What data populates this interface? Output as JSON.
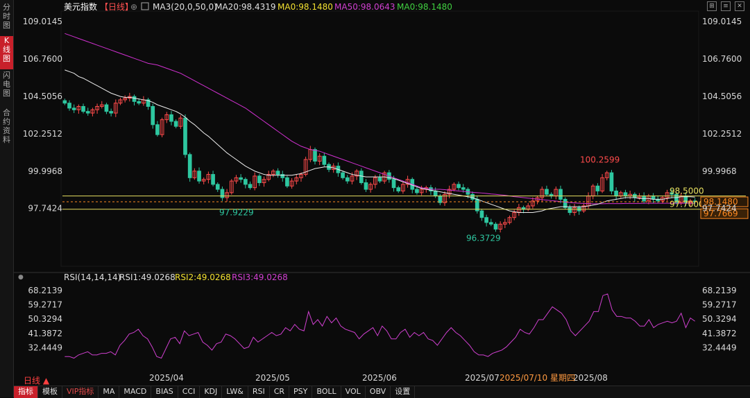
{
  "sidebar": {
    "tabs": [
      {
        "label": "分时图",
        "active": false
      },
      {
        "label": "K线图",
        "active": true
      },
      {
        "label": "闪电图",
        "active": false
      },
      {
        "label": "合约资料",
        "active": false
      }
    ]
  },
  "header": {
    "title": "美元指数",
    "period": "【日线】",
    "ma_legend": "MA3(20,0,50,0)",
    "ma20": "MA20:98.4319",
    "ma0a": "MA0:98.1480",
    "ma50": "MA50:98.0643",
    "ma0b": "MA0:98.1480"
  },
  "rsi_header": {
    "name": "RSI(14,14,14)",
    "rsi1": "RSI1:49.0268",
    "rsi2": "RSI2:49.0268",
    "rsi3": "RSI3:49.0268"
  },
  "period_label": "日线 ▲",
  "bottombar": {
    "items": [
      "指标",
      "模板",
      "VIP指标",
      "MA",
      "MACD",
      "BIAS",
      "CCI",
      "KDJ",
      "LW&",
      "RSI",
      "CR",
      "PSY",
      "BOLL",
      "VOL",
      "OBV",
      "设置"
    ]
  },
  "colors": {
    "up": "#ff4b4b",
    "down": "#2ec7a0",
    "ma20": "#ffffff",
    "ma50": "#d030d0",
    "rsi": "#d040d0",
    "hline": "#e8e060",
    "last_price_tag": "#ff8a20"
  },
  "chart_data": [
    {
      "type": "candlestick",
      "title": "美元指数",
      "y_ticks": [
        "109.0145",
        "106.7600",
        "104.5056",
        "102.2512",
        "99.9968",
        "97.7424"
      ],
      "ylim": [
        96.1,
        109.4
      ],
      "x_tick_labels": [
        "2025/04",
        "2025/05",
        "2025/06",
        "2025/07",
        "2025/08"
      ],
      "x_hover_label": "2025/07/10 星期四",
      "annotations": [
        {
          "text": "100.2599",
          "value": 100.2599,
          "kind": "high"
        },
        {
          "text": "97.9229",
          "value": 97.9229,
          "kind": "low"
        },
        {
          "text": "96.3729",
          "value": 96.3729,
          "kind": "low"
        }
      ],
      "horizontal_lines": [
        {
          "label": "98.5000",
          "value": 98.5
        },
        {
          "label": "97.7000",
          "value": 97.7
        }
      ],
      "price_tags": [
        {
          "label": "98.1480",
          "value": 98.148
        },
        {
          "label": "97.7669",
          "value": 97.7669
        }
      ],
      "closes": [
        104.1,
        103.8,
        103.7,
        103.9,
        103.6,
        103.5,
        103.7,
        103.9,
        104.0,
        103.6,
        103.5,
        104.1,
        104.3,
        104.4,
        104.5,
        104.2,
        104.1,
        104.3,
        103.9,
        102.8,
        102.2,
        103.1,
        103.4,
        103.0,
        102.7,
        103.2,
        101.0,
        99.6,
        100.0,
        99.4,
        99.5,
        99.8,
        99.2,
        98.9,
        98.4,
        98.7,
        99.4,
        99.6,
        99.5,
        99.2,
        99.0,
        99.7,
        99.3,
        99.5,
        99.8,
        100.0,
        99.8,
        99.6,
        99.1,
        99.4,
        99.6,
        99.8,
        100.7,
        101.3,
        100.6,
        100.9,
        100.4,
        100.1,
        100.3,
        99.9,
        99.6,
        99.4,
        99.7,
        100.0,
        99.3,
        98.9,
        99.2,
        99.6,
        99.4,
        99.9,
        99.5,
        99.0,
        98.8,
        99.2,
        99.5,
        98.9,
        98.7,
        98.9,
        99.0,
        98.8,
        98.5,
        98.1,
        98.6,
        98.9,
        99.2,
        99.0,
        98.9,
        98.6,
        98.3,
        97.6,
        97.2,
        96.9,
        96.8,
        96.5,
        96.8,
        96.9,
        97.2,
        97.5,
        97.8,
        97.7,
        97.9,
        98.2,
        98.4,
        98.9,
        98.6,
        98.5,
        98.9,
        98.3,
        97.8,
        97.5,
        97.8,
        97.6,
        97.9,
        98.5,
        99.1,
        98.8,
        99.6,
        99.9,
        98.8,
        98.5,
        98.7,
        98.5,
        98.6,
        98.4,
        98.5,
        98.2,
        98.5,
        98.3,
        98.2,
        98.4,
        98.7,
        98.6,
        98.1,
        98.5,
        98.1,
        98.2,
        98.15
      ],
      "ma20": [
        106.1,
        106.0,
        105.9,
        105.7,
        105.6,
        105.45,
        105.3,
        105.15,
        105.0,
        104.85,
        104.7,
        104.6,
        104.5,
        104.45,
        104.45,
        104.4,
        104.35,
        104.3,
        104.25,
        104.15,
        104.0,
        103.9,
        103.8,
        103.7,
        103.6,
        103.45,
        103.25,
        103.0,
        102.8,
        102.55,
        102.3,
        102.1,
        101.85,
        101.6,
        101.35,
        101.1,
        100.9,
        100.7,
        100.5,
        100.3,
        100.15,
        100.0,
        99.9,
        99.8,
        99.75,
        99.75,
        99.75,
        99.75,
        99.75,
        99.75,
        99.8,
        99.85,
        99.95,
        100.05,
        100.15,
        100.2,
        100.25,
        100.25,
        100.2,
        100.1,
        100.0,
        99.9,
        99.8,
        99.75,
        99.7,
        99.65,
        99.65,
        99.65,
        99.65,
        99.65,
        99.6,
        99.55,
        99.45,
        99.35,
        99.25,
        99.15,
        99.05,
        98.95,
        98.9,
        98.85,
        98.8,
        98.75,
        98.7,
        98.65,
        98.6,
        98.55,
        98.5,
        98.45,
        98.4,
        98.3,
        98.2,
        98.1,
        98.0,
        97.9,
        97.8,
        97.7,
        97.6,
        97.55,
        97.5,
        97.5,
        97.5,
        97.5,
        97.55,
        97.6,
        97.7,
        97.75,
        97.8,
        97.85,
        97.85,
        97.85,
        97.85,
        97.85,
        97.85,
        97.9,
        97.95,
        98.0,
        98.1,
        98.2,
        98.25,
        98.3,
        98.35,
        98.4,
        98.4,
        98.4,
        98.35,
        98.35,
        98.35,
        98.3,
        98.3,
        98.3,
        98.35,
        98.4,
        98.4,
        98.45,
        98.45,
        98.45,
        98.43
      ],
      "ma50": [
        108.3,
        108.2,
        108.1,
        108.0,
        107.9,
        107.8,
        107.7,
        107.6,
        107.5,
        107.4,
        107.3,
        107.2,
        107.1,
        107.0,
        106.9,
        106.8,
        106.7,
        106.6,
        106.5,
        106.45,
        106.4,
        106.3,
        106.2,
        106.1,
        106.0,
        105.9,
        105.75,
        105.6,
        105.45,
        105.3,
        105.15,
        105.0,
        104.85,
        104.7,
        104.55,
        104.4,
        104.25,
        104.1,
        103.95,
        103.8,
        103.6,
        103.4,
        103.2,
        103.0,
        102.8,
        102.6,
        102.4,
        102.2,
        102.0,
        101.8,
        101.65,
        101.5,
        101.4,
        101.3,
        101.25,
        101.2,
        101.1,
        101.0,
        100.9,
        100.8,
        100.7,
        100.6,
        100.5,
        100.4,
        100.3,
        100.2,
        100.1,
        100.0,
        99.9,
        99.8,
        99.7,
        99.6,
        99.5,
        99.4,
        99.3,
        99.2,
        99.1,
        99.0,
        98.95,
        98.9,
        98.9,
        98.9,
        98.88,
        98.85,
        98.83,
        98.8,
        98.78,
        98.75,
        98.72,
        98.7,
        98.68,
        98.65,
        98.62,
        98.6,
        98.57,
        98.54,
        98.5,
        98.46,
        98.43,
        98.4,
        98.37,
        98.34,
        98.31,
        98.28,
        98.25,
        98.22,
        98.19,
        98.16,
        98.13,
        98.1,
        98.08,
        98.06,
        98.05,
        98.04,
        98.03,
        98.03,
        98.03,
        98.04,
        98.04,
        98.04,
        98.04,
        98.05,
        98.05,
        98.05,
        98.05,
        98.06,
        98.06,
        98.06,
        98.06,
        98.06,
        98.06,
        98.06,
        98.06,
        98.06,
        98.06,
        98.06,
        98.06
      ]
    },
    {
      "type": "line",
      "title": "RSI(14,14,14)",
      "y_ticks": [
        "68.2139",
        "59.2717",
        "50.3294",
        "41.3872",
        "32.4449"
      ],
      "ylim": [
        24.5,
        72.0
      ],
      "values": [
        27,
        27,
        26,
        28,
        29,
        30,
        28,
        28,
        29,
        29,
        30,
        28,
        34,
        37,
        41,
        42,
        44,
        40,
        38,
        33,
        27,
        26,
        32,
        38,
        39,
        35,
        43,
        40,
        41,
        42,
        36,
        34,
        31,
        35,
        36,
        41,
        40,
        38,
        35,
        32,
        33,
        39,
        36,
        38,
        40,
        42,
        40,
        41,
        45,
        43,
        47,
        44,
        43,
        55,
        47,
        50,
        46,
        52,
        48,
        51,
        46,
        44,
        43,
        42,
        38,
        41,
        43,
        45,
        40,
        46,
        43,
        38,
        38,
        42,
        44,
        39,
        42,
        40,
        42,
        38,
        37,
        34,
        38,
        42,
        45,
        42,
        40,
        37,
        34,
        30,
        28,
        28,
        27,
        29,
        30,
        31,
        33,
        36,
        39,
        44,
        42,
        41,
        45,
        50,
        50,
        54,
        58,
        56,
        54,
        50,
        43,
        40,
        43,
        46,
        49,
        55,
        55,
        65,
        66,
        56,
        52,
        52,
        51,
        51,
        49,
        46,
        46,
        50,
        45,
        47,
        48,
        49,
        48,
        49,
        54,
        45,
        51,
        49
      ]
    }
  ]
}
